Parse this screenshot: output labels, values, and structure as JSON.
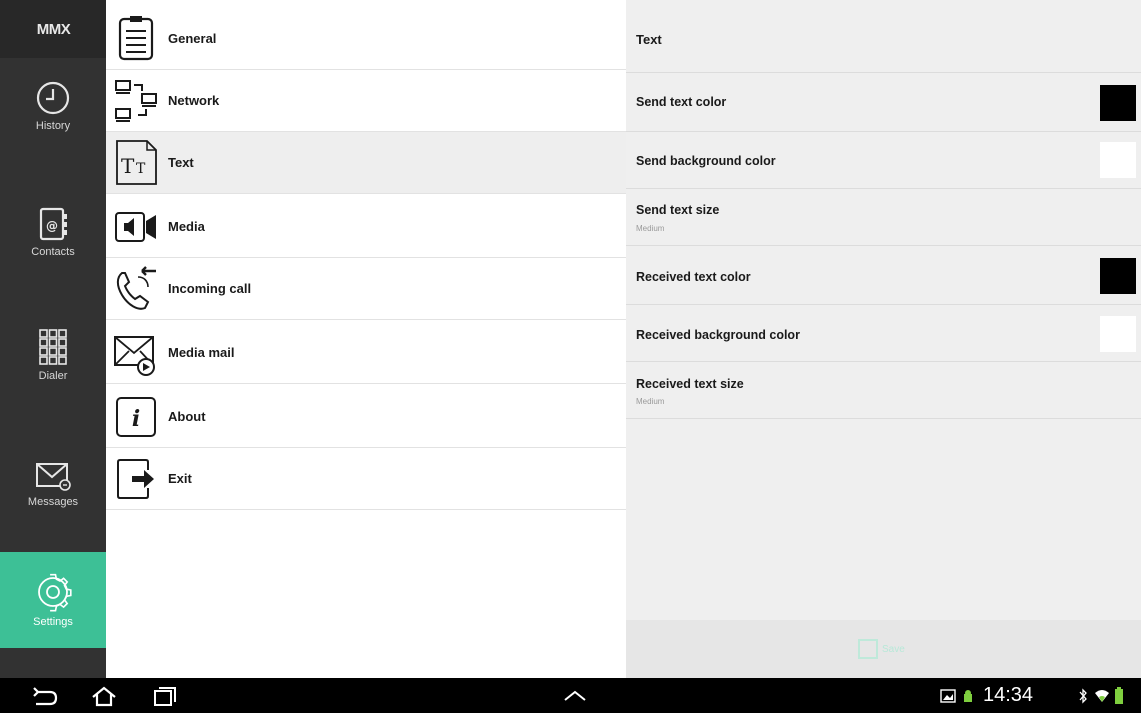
{
  "app": {
    "logo_sup": "",
    "logo": "MMX"
  },
  "rail": {
    "items": [
      {
        "label": "History",
        "icon": "clock-icon"
      },
      {
        "label": "Contacts",
        "icon": "contact-book-icon"
      },
      {
        "label": "Dialer",
        "icon": "dialpad-icon"
      },
      {
        "label": "Messages",
        "icon": "envelope-icon"
      },
      {
        "label": "Settings",
        "icon": "gear-icon",
        "active": true
      }
    ]
  },
  "menu": {
    "items": [
      {
        "label": "General",
        "icon": "document-lines-icon"
      },
      {
        "label": "Network",
        "icon": "network-icon"
      },
      {
        "label": "Text",
        "icon": "text-size-icon",
        "selected": true
      },
      {
        "label": "Media",
        "icon": "media-camera-icon"
      },
      {
        "label": "Incoming call",
        "icon": "incoming-call-icon"
      },
      {
        "label": "Media mail",
        "icon": "media-mail-icon"
      },
      {
        "label": "About",
        "icon": "info-icon"
      },
      {
        "label": "Exit",
        "icon": "exit-icon"
      }
    ]
  },
  "panel": {
    "title": "Text",
    "rows": [
      {
        "label": "Send text color",
        "swatch": "#000000"
      },
      {
        "label": "Send background color",
        "swatch": "#ffffff"
      },
      {
        "label": "Send text size",
        "sub": "Medium"
      },
      {
        "label": "Received text color",
        "swatch": "#000000"
      },
      {
        "label": "Received background color",
        "swatch": "#ffffff"
      },
      {
        "label": "Received text size",
        "sub": "Medium"
      }
    ],
    "save_label": "Save"
  },
  "system": {
    "time": "14:34"
  },
  "colors": {
    "accent": "#3dc096",
    "rail": "#323232",
    "panel": "#efefef"
  }
}
